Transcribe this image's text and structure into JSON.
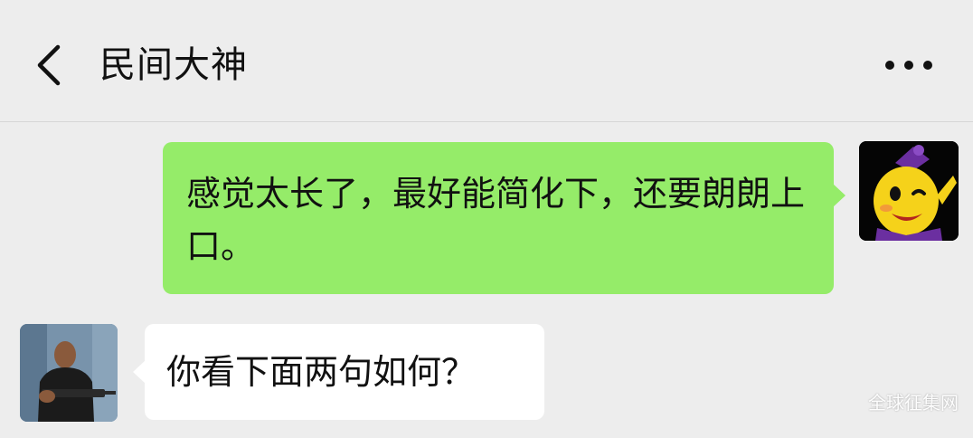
{
  "header": {
    "title": "民间大神",
    "back_icon": "chevron-left-icon",
    "more_icon": "more-dots-icon"
  },
  "messages": [
    {
      "direction": "outgoing",
      "text": "感觉太长了，最好能简化下，还要朗朗上口。"
    },
    {
      "direction": "incoming",
      "text": "你看下面两句如何？"
    }
  ],
  "colors": {
    "background": "#ededed",
    "outgoing_bubble": "#95ec69",
    "incoming_bubble": "#ffffff"
  },
  "watermark": "全球征集网"
}
